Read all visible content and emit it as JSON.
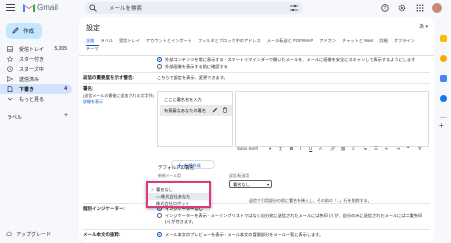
{
  "app": {
    "name": "Gmail",
    "search_placeholder": "メールを検索"
  },
  "compose": {
    "label": "作成"
  },
  "sidebar": {
    "items": [
      {
        "label": "受信トレイ",
        "count": "5,205",
        "active": false
      },
      {
        "label": "スター付き",
        "count": "",
        "active": false
      },
      {
        "label": "スヌーズ中",
        "count": "",
        "active": false
      },
      {
        "label": "送信済み",
        "count": "",
        "active": false
      },
      {
        "label": "下書き",
        "count": "4",
        "active": true
      },
      {
        "label": "もっと見る",
        "count": "",
        "active": false
      }
    ],
    "labels_heading": "ラベル",
    "labels_plus": "+",
    "upgrade": "アップグレード"
  },
  "settings": {
    "title": "設定",
    "language_toggle": "あ ▾",
    "tabs": [
      {
        "label": "全般",
        "active": true
      },
      {
        "label": "ラベル",
        "active": false
      },
      {
        "label": "受信トレイ",
        "active": false
      },
      {
        "label": "アカウントとインポート",
        "active": false
      },
      {
        "label": "フィルタとブロック中のアドレス",
        "active": false
      },
      {
        "label": "メール転送と POP/IMAP",
        "active": false
      },
      {
        "label": "アドオン",
        "active": false
      },
      {
        "label": "チャットと Meet",
        "active": false
      },
      {
        "label": "詳細",
        "active": false
      },
      {
        "label": "オフライン",
        "active": false
      },
      {
        "label": "テーマ",
        "active": false
      }
    ],
    "external_images": {
      "option_on": "外部コンテンツを常に表示する - スマートリマインダーで開いたメールを、メールに画像を安全にスキャンして表示するようにします",
      "option_off": "外部画像を表示する前に確認する"
    },
    "importance_row": {
      "label": "返信の重要度を示す警告:",
      "text": "こちらで設定を表示、変更できます。"
    },
    "signature": {
      "label": "署名:",
      "sub": "(送信メールの最後に追加される文字列)",
      "link": "詳細を表示",
      "items": [
        {
          "label": "ここに署名名を入力",
          "selected": false
        },
        {
          "label": "有意義なあなたの署名",
          "selected": true
        }
      ],
      "font": "Sans Serif",
      "toolbar_buttons": [
        "T̲",
        "B",
        "I",
        "U",
        "A",
        "🔗",
        "▨",
        "≡",
        "≔",
        "☰",
        "⇤",
        "⇥",
        "❝",
        "T̸"
      ],
      "new_button": "新規作成"
    },
    "defaults": {
      "title": "デフォルトの署名",
      "for_new_label": "新規メール用",
      "for_reply_label": "返信/転送用",
      "reply_selected": "署名なし",
      "dropdown_options": [
        {
          "label": "署名なし",
          "checked": true
        },
        {
          "label": "○○株式会社あなた",
          "checked": false
        },
        {
          "label": "株式会社ロボット",
          "checked": false
        }
      ],
      "note": "返信で引用部分の前に署名を挿入し、その前の「--」行を削除する。"
    },
    "personal_indicators": {
      "label": "個別インジケーター:",
      "option_off": "インジケーターなし",
      "option_on": "インジケーターを表示 - メーリングリストではなく自分宛に送信されたメールには矢印 (›) が、自分のみに送信されたメールには二重矢印 (») が付きます。"
    },
    "snippets": {
      "label": "メール本文の抜粋:",
      "option": "メール本文のプレビューを表示 - メール本文の冒頭部分をメール一覧に表示します。"
    }
  },
  "colors": {
    "accent": "#0b57d0",
    "compose_bg": "#c2e7ff",
    "active_nav": "#d3e3fd",
    "highlight_border": "#d93a80",
    "page_bg": "#f6f8fc"
  },
  "icons": {
    "menu": "menu-icon",
    "search": "search-icon",
    "tune": "tune-icon",
    "help": "help-icon",
    "settings": "gear-icon",
    "apps": "apps-grid-icon"
  }
}
